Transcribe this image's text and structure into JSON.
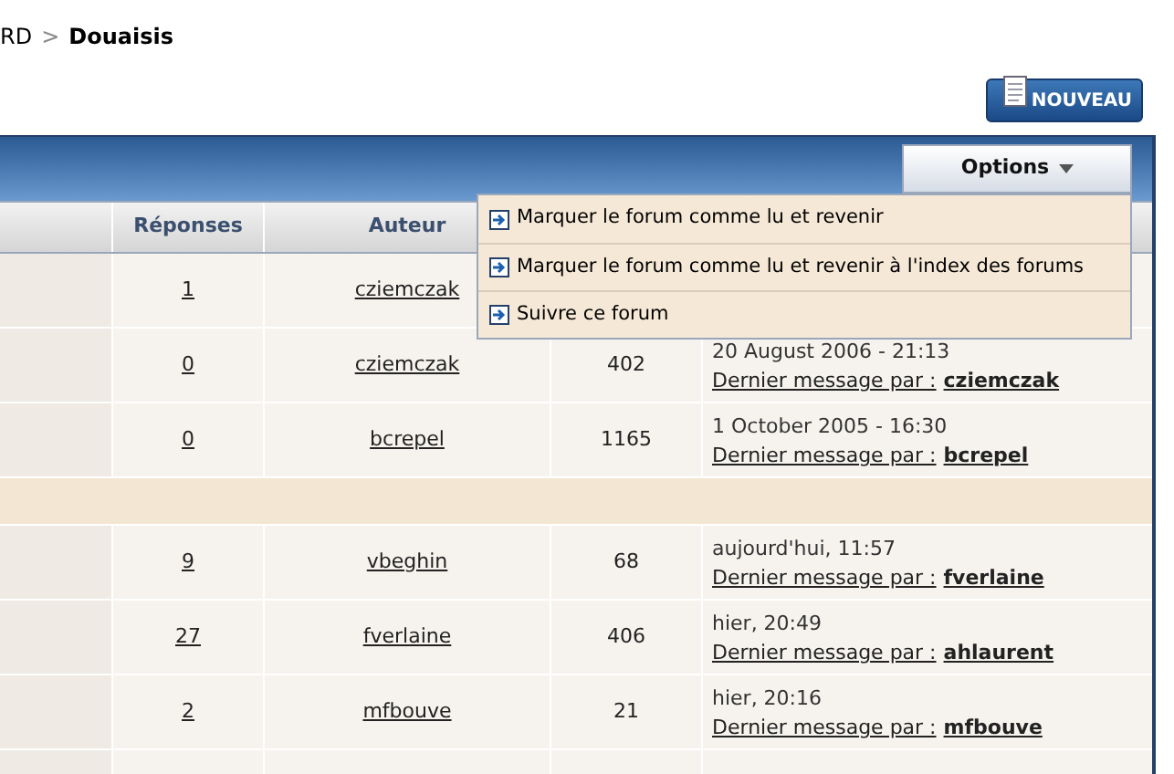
{
  "breadcrumb": {
    "parent": "RD",
    "separator": ">",
    "current": "Douaisis"
  },
  "new_button": "NOUVEAU",
  "options_button": {
    "label": "Options",
    "expanded": true
  },
  "options_menu": [
    "Marquer le forum comme lu et revenir",
    "Marquer le forum comme lu et revenir à l'index des forums",
    "Suivre ce forum"
  ],
  "columns": [
    "Réponses",
    "Auteur"
  ],
  "rows": [
    {
      "kind": "topic",
      "replies": "1",
      "author": "cziemczak"
    },
    {
      "kind": "topic",
      "replies": "0",
      "author": "cziemczak",
      "views": "402",
      "last_date": "20 August 2006 - 21:13",
      "last_label": "Dernier message par :",
      "last_by": "cziemczak"
    },
    {
      "kind": "topic",
      "replies": "0",
      "author": "bcrepel",
      "views": "1165",
      "last_date": "1 October 2005 - 16:30",
      "last_label": "Dernier message par :",
      "last_by": "bcrepel"
    },
    {
      "kind": "section"
    },
    {
      "kind": "topic",
      "replies": "9",
      "author": "vbeghin",
      "views": "68",
      "last_date": "aujourd'hui, 11:57",
      "last_label": "Dernier message par :",
      "last_by": "fverlaine"
    },
    {
      "kind": "topic",
      "replies": "27",
      "author": "fverlaine",
      "views": "406",
      "last_date": "hier, 20:49",
      "last_label": "Dernier message par :",
      "last_by": "ahlaurent"
    },
    {
      "kind": "topic",
      "replies": "2",
      "author": "mfbouve",
      "views": "21",
      "last_date": "hier, 20:16",
      "last_label": "Dernier message par :",
      "last_by": "mfbouve"
    },
    {
      "kind": "topic"
    }
  ]
}
